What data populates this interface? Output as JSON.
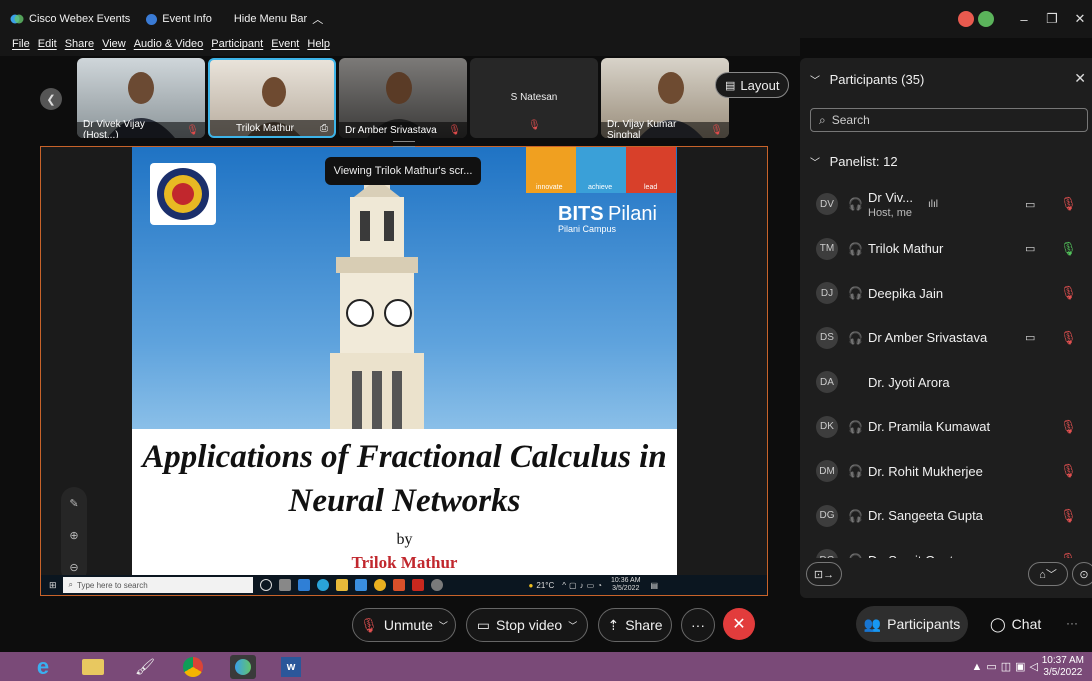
{
  "titlebar": {
    "app": "Cisco Webex Events",
    "event_info": "Event Info",
    "hide_menu": "Hide Menu Bar"
  },
  "menu": [
    "File",
    "Edit",
    "Share",
    "View",
    "Audio & Video",
    "Participant",
    "Event",
    "Help"
  ],
  "filmstrip": [
    {
      "name": "Dr Vivek Vijay  (Host...)",
      "has_video": true
    },
    {
      "name": "Trilok Mathur",
      "has_video": true,
      "active": true
    },
    {
      "name": "Dr Amber Srivastava",
      "has_video": true
    },
    {
      "name": "S Natesan",
      "has_video": false
    },
    {
      "name": "Dr. Vijay Kumar Singhal",
      "has_video": true
    }
  ],
  "layout_label": "Layout",
  "stage": {
    "viewing": "Viewing Trilok Mathur's scr...",
    "slide": {
      "tag_innovate": "innovate",
      "tag_achieve": "achieve",
      "tag_lead": "lead",
      "brand": "BITS",
      "brand_suffix": "Pilani",
      "campus": "Pilani Campus",
      "title_line1": "Applications of Fractional Calculus in",
      "title_line2": "Neural Networks",
      "by": "by",
      "author": "Trilok Mathur"
    },
    "inner_taskbar": {
      "search": "Type here to search",
      "weather": "21°C",
      "time": "10:36 AM",
      "date": "3/5/2022"
    }
  },
  "panel": {
    "title": "Participants (35)",
    "search_placeholder": "Search",
    "group": "Panelist: 12",
    "participants": [
      {
        "initials": "DV",
        "name": "Dr Viv...",
        "sub": "Host, me",
        "camera": true,
        "mic": "muted"
      },
      {
        "initials": "TM",
        "name": "Trilok Mathur",
        "sub": "",
        "camera": true,
        "mic": "active"
      },
      {
        "initials": "DJ",
        "name": "Deepika Jain",
        "sub": "",
        "camera": false,
        "mic": "muted"
      },
      {
        "initials": "DS",
        "name": "Dr Amber Srivastava",
        "sub": "",
        "camera": true,
        "mic": "muted"
      },
      {
        "initials": "DA",
        "name": "Dr. Jyoti Arora",
        "sub": "",
        "camera": false,
        "mic": "none"
      },
      {
        "initials": "DK",
        "name": "Dr. Pramila Kumawat",
        "sub": "",
        "camera": false,
        "mic": "muted"
      },
      {
        "initials": "DM",
        "name": "Dr. Rohit Mukherjee",
        "sub": "",
        "camera": false,
        "mic": "muted"
      },
      {
        "initials": "DG",
        "name": "Dr. Sangeeta Gupta",
        "sub": "",
        "camera": false,
        "mic": "muted"
      },
      {
        "initials": "DG",
        "name": "Dr. Sumit Gupta",
        "sub": "",
        "camera": false,
        "mic": "muted"
      }
    ]
  },
  "controls": {
    "unmute": "Unmute",
    "stop_video": "Stop video",
    "share": "Share",
    "participants": "Participants",
    "chat": "Chat"
  },
  "windows_taskbar": {
    "time": "10:37 AM",
    "date": "3/5/2022"
  },
  "colors": {
    "accent_orange": "#c8632a",
    "mute_red": "#e05050",
    "end_red": "#e23c3c",
    "taskbar_purple": "#7a4a78"
  }
}
